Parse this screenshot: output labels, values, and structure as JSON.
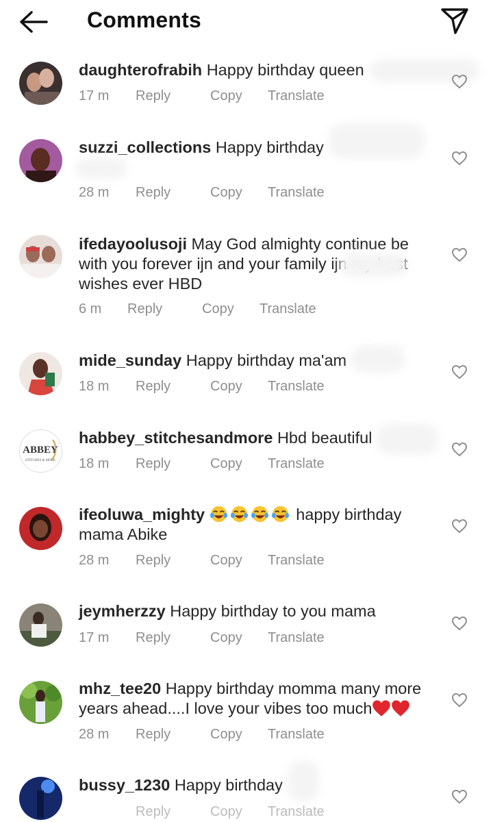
{
  "header": {
    "title": "Comments",
    "back_icon": "arrow-left-icon",
    "send_icon": "paper-plane-icon"
  },
  "actions": {
    "reply": "Reply",
    "copy": "Copy",
    "translate": "Translate"
  },
  "comments": [
    {
      "username": "daughterofrabih",
      "text": "Happy birthday queen",
      "time": "17 m"
    },
    {
      "username": "suzzi_collections",
      "text": "Happy birthday",
      "time": "28 m"
    },
    {
      "username": "ifedayoolusoji",
      "text": "May God almighty continue be with you forever ijn and your family ijn my best wishes ever HBD",
      "time": "6 m"
    },
    {
      "username": "mide_sunday",
      "text": "Happy birthday ma'am",
      "time": "18 m"
    },
    {
      "username": "habbey_stitchesandmore",
      "text": "Hbd beautiful",
      "time": "18 m",
      "avatar_logo_text": "ABBEY",
      "avatar_logo_sub": "STITCHES & MORE"
    },
    {
      "username": "ifeoluwa_mighty",
      "text": "happy birthday mama Abike",
      "time": "28 m"
    },
    {
      "username": "jeymherzzy",
      "text": "Happy birthday to you mama",
      "time": "17 m"
    },
    {
      "username": "mhz_tee20",
      "text": "Happy birthday momma many more years ahead....I love your vibes too much",
      "time": "28 m"
    },
    {
      "username": "bussy_1230",
      "text": "Happy birthday",
      "time": ""
    }
  ],
  "colors": {
    "text": "#262626",
    "meta": "#8e8e8e",
    "heart_outline": "#8e8e8e",
    "emoji_heart": "#e0262c"
  }
}
